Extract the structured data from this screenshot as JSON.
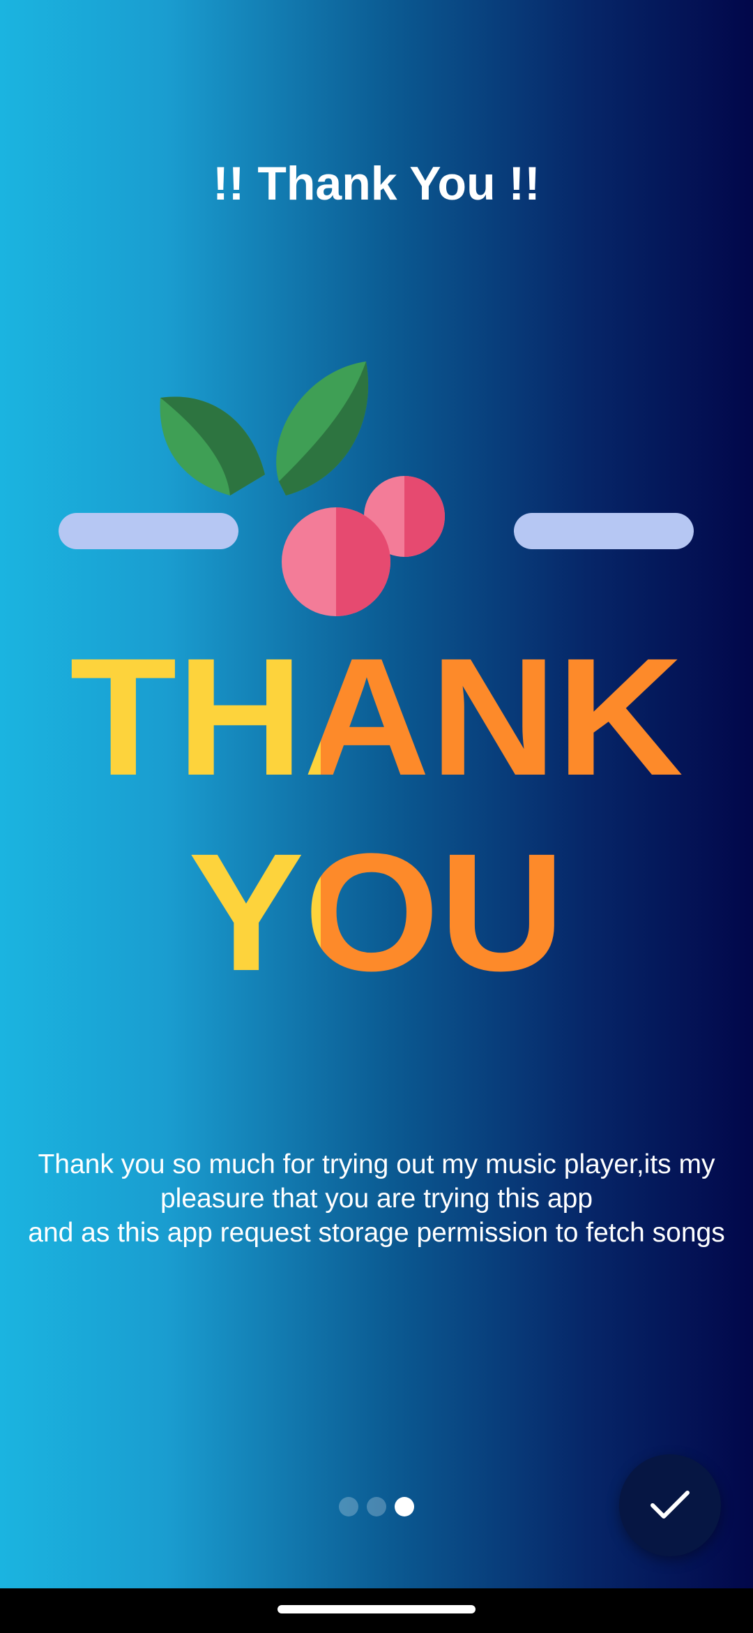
{
  "title": "!! Thank You !!",
  "illustration": {
    "icon": "thank-you-illustration",
    "word1": "THANK",
    "word2": "YOU",
    "colors": {
      "yellow": "#fdd33c",
      "orange": "#fd8a2a",
      "leaf_light": "#3f9f55",
      "leaf_dark": "#2d7440",
      "berry_light": "#f37c98",
      "berry_dark": "#e64a70",
      "dash": "#b6c7f3"
    }
  },
  "message": "Thank you so much for trying out my music player,its my pleasure that you are trying this app\nand as this app request storage permission to fetch songs",
  "pager": {
    "count": 3,
    "active_index": 2
  },
  "fab": {
    "icon": "check-icon",
    "background": "#061643"
  },
  "colors": {
    "gradient_start": "#1bb4e0",
    "gradient_end": "#02074a"
  }
}
